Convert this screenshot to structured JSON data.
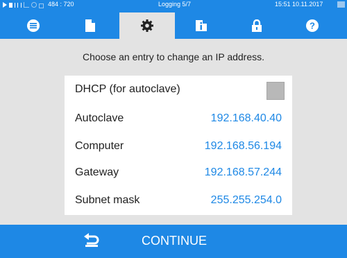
{
  "status_bar": {
    "coords": "484 : 720",
    "mode": "Logging 5/7",
    "datetime": "15:51  10.11.2017"
  },
  "tabs": [
    {
      "icon": "menu-list-icon"
    },
    {
      "icon": "document-icon"
    },
    {
      "icon": "gear-icon",
      "active": true
    },
    {
      "icon": "info-book-icon"
    },
    {
      "icon": "lock-icon"
    },
    {
      "icon": "help-icon"
    }
  ],
  "prompt": "Choose an entry to change an IP address.",
  "settings": {
    "dhcp_label": "DHCP (for autoclave)",
    "dhcp_checked": false,
    "rows": [
      {
        "label": "Autoclave",
        "value": "192.168.40.40"
      },
      {
        "label": "Computer",
        "value": "192.168.56.194"
      },
      {
        "label": "Gateway",
        "value": "192.168.57.244"
      },
      {
        "label": "Subnet mask",
        "value": "255.255.254.0"
      }
    ]
  },
  "continue_label": "CONTINUE",
  "colors": {
    "accent": "#1e88e5",
    "background": "#e3e3e3",
    "panel": "#ffffff",
    "checkbox": "#b8b8b8"
  }
}
